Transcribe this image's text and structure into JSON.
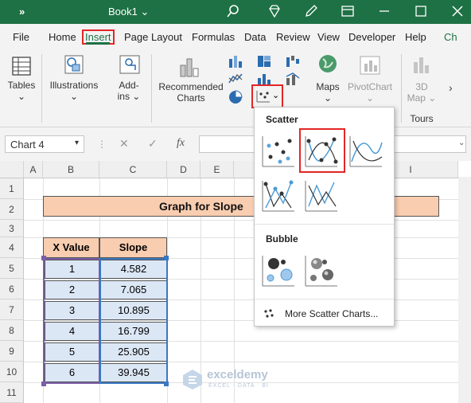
{
  "titlebar": {
    "chevron": "»",
    "book": "Book1",
    "book_chevron": "⌄"
  },
  "tabs": [
    "File",
    "Home",
    "Insert",
    "Page Layout",
    "Formulas",
    "Data",
    "Review",
    "View",
    "Developer",
    "Help",
    "Ch"
  ],
  "ribbon": {
    "tables": "Tables",
    "illustrations": "Illustrations",
    "addins_1": "Add-",
    "addins_2": "ins",
    "recommended_1": "Recommended",
    "recommended_2": "Charts",
    "maps": "Maps",
    "pivotchart": "PivotChart",
    "map3d_1": "3D",
    "map3d_2": "Map",
    "tours": "Tours"
  },
  "formula": {
    "namebox": "Chart 4",
    "fx": "fx"
  },
  "columns": [
    "A",
    "B",
    "C",
    "D",
    "E",
    "I"
  ],
  "rows": [
    "1",
    "2",
    "3",
    "4",
    "5",
    "6",
    "7",
    "8",
    "9",
    "10",
    "11"
  ],
  "banner": "Graph for Slope",
  "table": {
    "headers": [
      "X Value",
      "Slope"
    ],
    "rows": [
      [
        "1",
        "4.582"
      ],
      [
        "2",
        "7.065"
      ],
      [
        "3",
        "10.895"
      ],
      [
        "4",
        "16.799"
      ],
      [
        "5",
        "25.905"
      ],
      [
        "6",
        "39.945"
      ]
    ]
  },
  "dropdown": {
    "scatter": "Scatter",
    "bubble": "Bubble",
    "more": "More Scatter Charts..."
  },
  "watermark": {
    "name": "exceldemy",
    "tagline": "EXCEL · DATA · BI"
  },
  "colors": {
    "excel_green": "#1e7145",
    "highlight_red": "#e32626",
    "header_fill": "#f9cdb0",
    "cell_fill": "#dce7f6"
  }
}
